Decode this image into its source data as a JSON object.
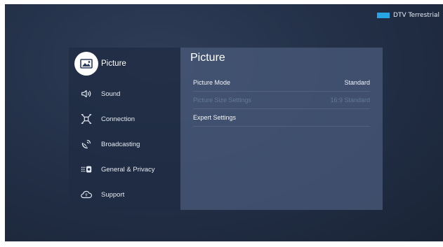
{
  "source_indicator": {
    "label": "DTV Terrestrial",
    "color": "#27a6e6"
  },
  "sidebar": {
    "items": [
      {
        "label": "Picture",
        "icon": "picture-icon",
        "selected": true
      },
      {
        "label": "Sound",
        "icon": "speaker-icon"
      },
      {
        "label": "Connection",
        "icon": "connection-icon"
      },
      {
        "label": "Broadcasting",
        "icon": "satellite-icon"
      },
      {
        "label": "General & Privacy",
        "icon": "general-settings-icon"
      },
      {
        "label": "Support",
        "icon": "support-cloud-icon"
      }
    ]
  },
  "panel": {
    "title": "Picture",
    "rows": [
      {
        "label": "Picture Mode",
        "value": "Standard",
        "enabled": true
      },
      {
        "label": "Picture Size Settings",
        "value": "16:9 Standard",
        "enabled": false
      },
      {
        "label": "Expert Settings",
        "value": "",
        "enabled": true
      }
    ]
  },
  "colors": {
    "background": "#233048",
    "sidebar_bg": "#1f2b42",
    "panel_bg": "#485978",
    "disabled_text": "#64789a"
  }
}
